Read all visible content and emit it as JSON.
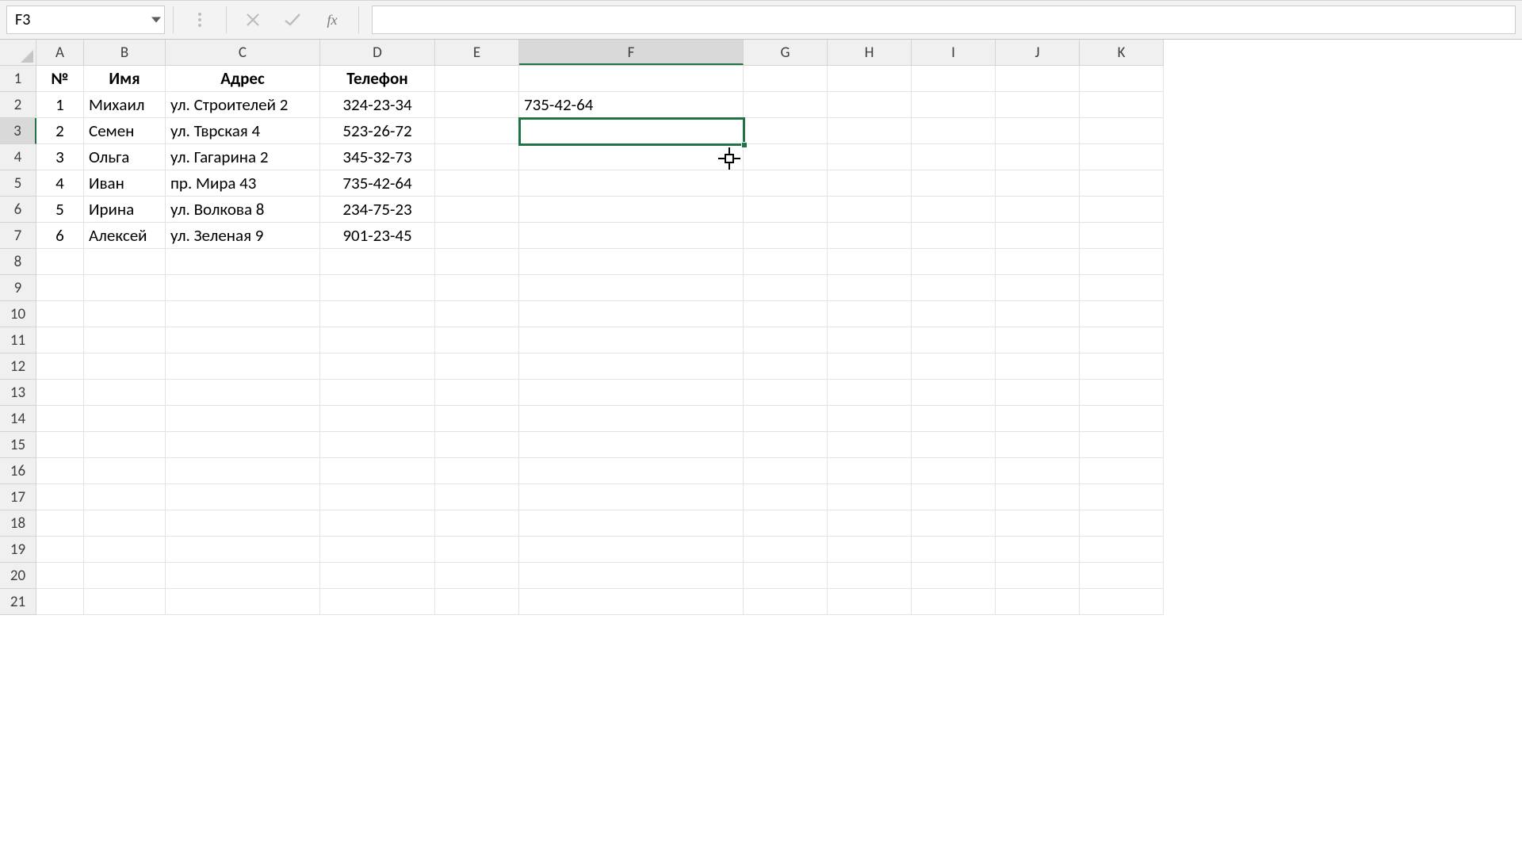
{
  "nameBox": {
    "value": "F3"
  },
  "formulaBar": {
    "fxLabel": "fx",
    "value": ""
  },
  "columnLetters": [
    "A",
    "B",
    "C",
    "D",
    "E",
    "F",
    "G",
    "H",
    "I",
    "J",
    "K"
  ],
  "rowNumbers": [
    "1",
    "2",
    "3",
    "4",
    "5",
    "6",
    "7",
    "8",
    "9",
    "10",
    "11",
    "12",
    "13",
    "14",
    "15",
    "16",
    "17",
    "18",
    "19",
    "20",
    "21"
  ],
  "selectedCol": "F",
  "selectedRow": "3",
  "table": {
    "headers": {
      "no": "№",
      "name": "Имя",
      "address": "Адрес",
      "phone": "Телефон"
    },
    "rows": [
      {
        "no": "1",
        "name": "Михаил",
        "address": "ул. Строителей 2",
        "phone": "324-23-34"
      },
      {
        "no": "2",
        "name": "Семен",
        "address": "ул. Тврская 4",
        "phone": "523-26-72"
      },
      {
        "no": "3",
        "name": "Ольга",
        "address": "ул. Гагарина 2",
        "phone": "345-32-73"
      },
      {
        "no": "4",
        "name": "Иван",
        "address": "пр. Мира 43",
        "phone": "735-42-64"
      },
      {
        "no": "5",
        "name": "Ирина",
        "address": "ул. Волкова 8",
        "phone": "234-75-23"
      },
      {
        "no": "6",
        "name": "Алексей",
        "address": "ул. Зеленая 9",
        "phone": "901-23-45"
      }
    ]
  },
  "isolatedCells": {
    "F2": "735-42-64"
  },
  "colors": {
    "selectionGreen": "#217346"
  }
}
